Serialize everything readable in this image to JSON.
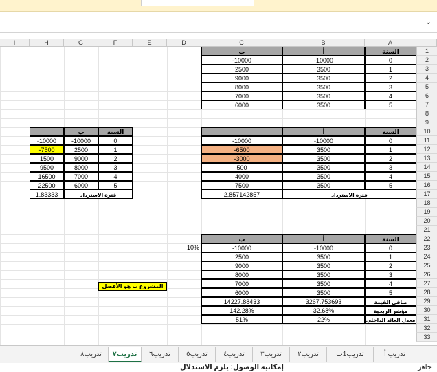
{
  "formula_bar": {
    "chevron": "⌄"
  },
  "columns": [
    "A",
    "B",
    "C",
    "D",
    "E",
    "F",
    "G",
    "H",
    "I"
  ],
  "rows": [
    "1",
    "2",
    "3",
    "4",
    "5",
    "6",
    "7",
    "8",
    "9",
    "10",
    "11",
    "12",
    "13",
    "14",
    "15",
    "16",
    "17",
    "18",
    "19",
    "20",
    "21",
    "22",
    "23",
    "24",
    "25",
    "26",
    "27",
    "28",
    "29",
    "30",
    "31",
    "32",
    "33"
  ],
  "table1": {
    "headers": [
      "السنة",
      "أ",
      "ب"
    ],
    "rows": [
      [
        "0",
        "-10000",
        "-10000"
      ],
      [
        "1",
        "3500",
        "2500"
      ],
      [
        "2",
        "3500",
        "9000"
      ],
      [
        "3",
        "3500",
        "8000"
      ],
      [
        "4",
        "3500",
        "7000"
      ],
      [
        "5",
        "3500",
        "6000"
      ]
    ]
  },
  "table2": {
    "headers": [
      "السنة",
      "أ",
      ""
    ],
    "rows": [
      [
        "0",
        "-10000",
        "-10000"
      ],
      [
        "1",
        "3500",
        "-6500"
      ],
      [
        "2",
        "3500",
        "-3000"
      ],
      [
        "3",
        "3500",
        "500"
      ],
      [
        "4",
        "3500",
        "4000"
      ],
      [
        "5",
        "3500",
        "7500"
      ]
    ],
    "payback_label": "فترة الاسترداد",
    "payback_value": "2.857142857"
  },
  "table3": {
    "headers": [
      "السنة",
      "ب",
      ""
    ],
    "rows": [
      [
        "0",
        "-10000",
        "-10000"
      ],
      [
        "1",
        "2500",
        "-7500"
      ],
      [
        "2",
        "9000",
        "1500"
      ],
      [
        "3",
        "8000",
        "9500"
      ],
      [
        "4",
        "7000",
        "16500"
      ],
      [
        "5",
        "6000",
        "22500"
      ]
    ],
    "payback_label": "فترة الاسترداد",
    "payback_value": "1.83333"
  },
  "table4": {
    "headers": [
      "السنة",
      "أ",
      "ب"
    ],
    "rate": "10%",
    "rows": [
      [
        "0",
        "-10000",
        "-10000"
      ],
      [
        "1",
        "3500",
        "2500"
      ],
      [
        "2",
        "3500",
        "9000"
      ],
      [
        "3",
        "3500",
        "8000"
      ],
      [
        "4",
        "3500",
        "7000"
      ],
      [
        "5",
        "3500",
        "6000"
      ]
    ],
    "metrics": [
      {
        "label": "صافي القيمة",
        "a": "3267.753693",
        "b": "14227.88433"
      },
      {
        "label": "مؤشر الربحية",
        "a": "32.68%",
        "b": "142.28%"
      },
      {
        "label": "معدل العائد الداخلي",
        "a": "22%",
        "b": "51%"
      }
    ]
  },
  "best_note": "المشروع ب هو الأفضل",
  "tabs": [
    {
      "label": "تدريب أ",
      "active": false
    },
    {
      "label": "تدريب1ب",
      "active": false
    },
    {
      "label": "تدريب٢",
      "active": false
    },
    {
      "label": "تدريب٣",
      "active": false
    },
    {
      "label": "تدريب٤",
      "active": false
    },
    {
      "label": "تدريب٥",
      "active": false
    },
    {
      "label": "تدريب٦",
      "active": false
    },
    {
      "label": "تدريب٧",
      "active": true
    },
    {
      "label": "تدريب٨",
      "active": false
    }
  ],
  "status": {
    "left": "جاهز",
    "right": "إمكانية الوصول: يلزم الاستدلال"
  },
  "colors": {
    "header_gray": "#a6a6a6",
    "orange": "#f4b183",
    "yellow": "#ffff00",
    "active_tab": "#1e7145"
  }
}
